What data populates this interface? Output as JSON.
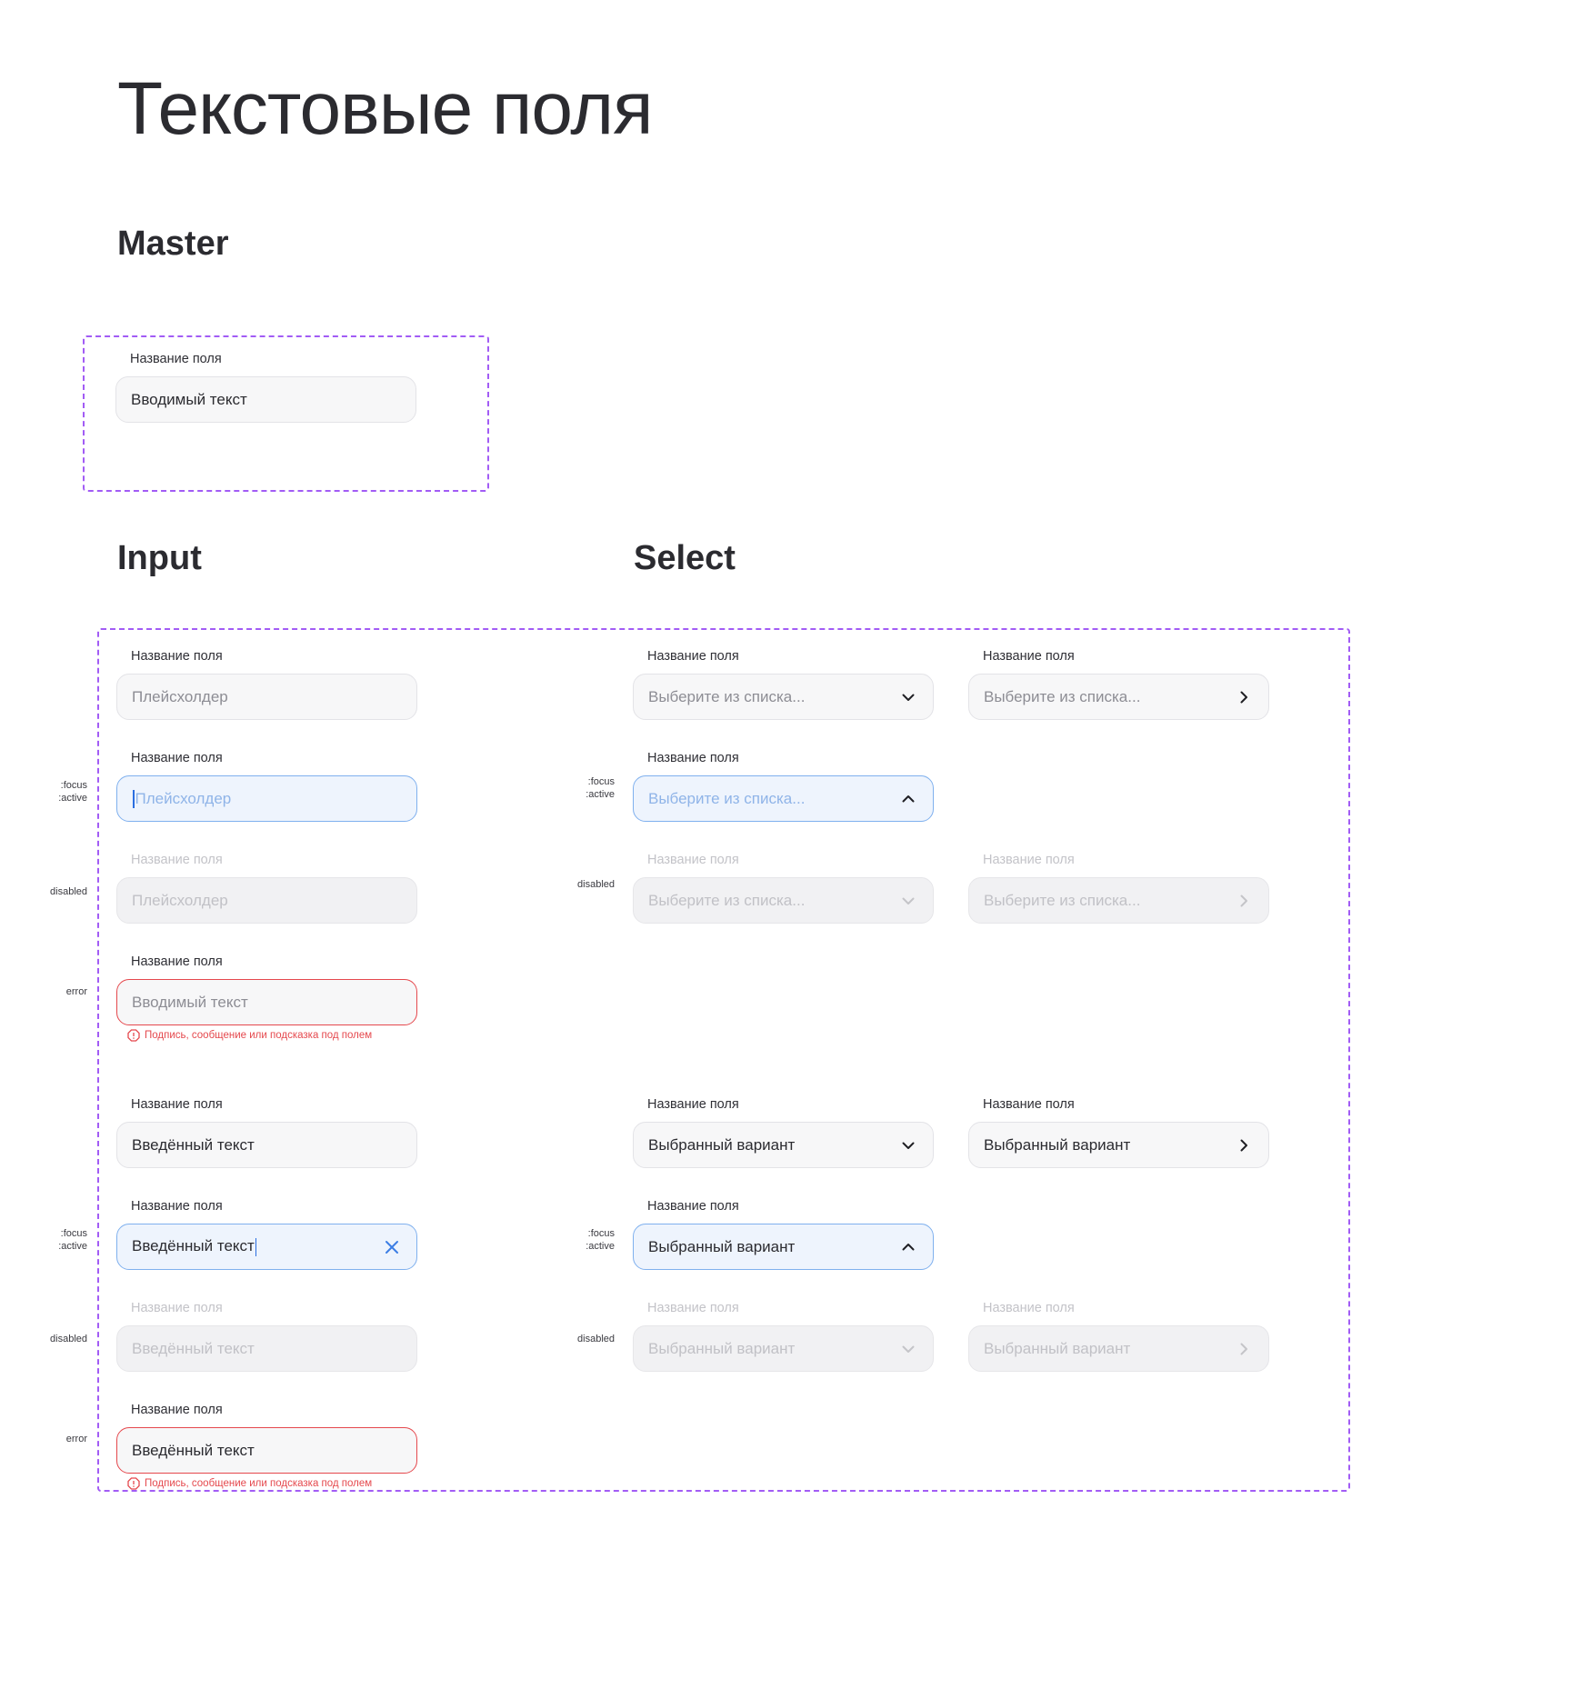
{
  "page_title": "Текстовые поля",
  "sections": {
    "master": "Master",
    "input": "Input",
    "select": "Select"
  },
  "states": {
    "focus": ":focus",
    "active": ":active",
    "disabled": "disabled",
    "error": "error"
  },
  "master_field": {
    "label": "Название поля",
    "value": "Вводимый текст"
  },
  "field_label": "Название поля",
  "input": {
    "placeholder": "Плейсхолдер",
    "error_value_placeholder": "Вводимый текст",
    "entered_value": "Введённый текст",
    "hint": "Подпись, сообщение или подсказка под полем"
  },
  "select": {
    "placeholder": "Выберите из списка...",
    "selected_value": "Выбранный вариант"
  },
  "icons": {
    "dropdown": "chevron-down-icon",
    "dropdown_open": "chevron-up-icon",
    "navigate": "chevron-right-icon",
    "clear": "close-icon",
    "error": "alert-octagon-icon"
  },
  "colors": {
    "frame_border": "#a25cf5",
    "focus_border": "#7fb0ee",
    "focus_background": "#eef4fd",
    "error": "#e5484d",
    "field_background": "#f7f7f8"
  }
}
